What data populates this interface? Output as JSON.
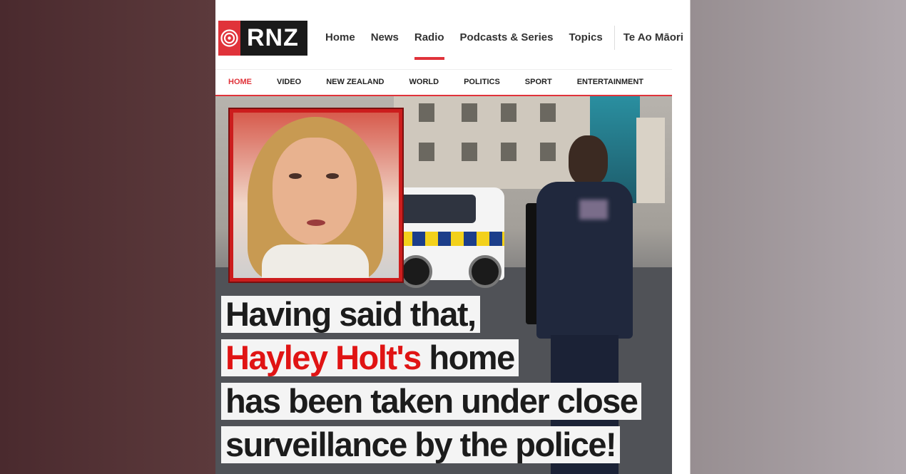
{
  "header": {
    "logo_text": "RNZ",
    "nav": [
      "Home",
      "News",
      "Radio",
      "Podcasts & Series",
      "Topics",
      "Te Ao Māori"
    ],
    "active_nav": "Radio"
  },
  "subnav": [
    "HOME",
    "VIDEO",
    "NEW ZEALAND",
    "WORLD",
    "POLITICS",
    "SPORT",
    "ENTERTAINMENT"
  ],
  "hero": {
    "caption": {
      "line1": "Having said that,",
      "line2_highlight": "Hayley Holt's",
      "line2_rest": " home",
      "line3": "has been taken under close",
      "line4": "surveillance by the police!"
    },
    "highlight_color": "#e01414"
  },
  "colors": {
    "accent": "#e0333a",
    "logo_bg": "#1a1a1a"
  }
}
